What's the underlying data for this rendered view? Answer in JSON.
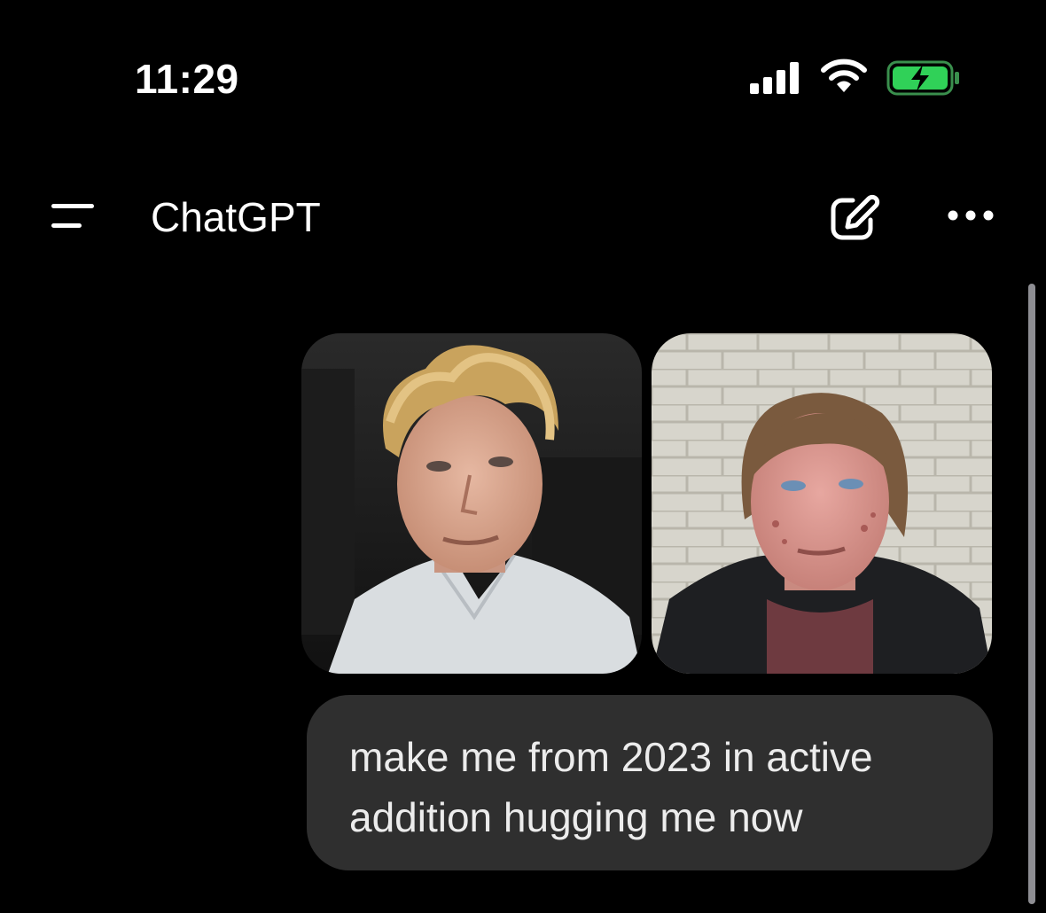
{
  "status_bar": {
    "time": "11:29",
    "battery_color": "#30d158"
  },
  "header": {
    "title": "ChatGPT"
  },
  "message": {
    "text": "make me from 2023 in active addition hugging me now"
  },
  "images": [
    {
      "name": "photo-1",
      "icon": "person-photo-blonde-hair"
    },
    {
      "name": "photo-2",
      "icon": "person-photo-brick-wall"
    }
  ]
}
